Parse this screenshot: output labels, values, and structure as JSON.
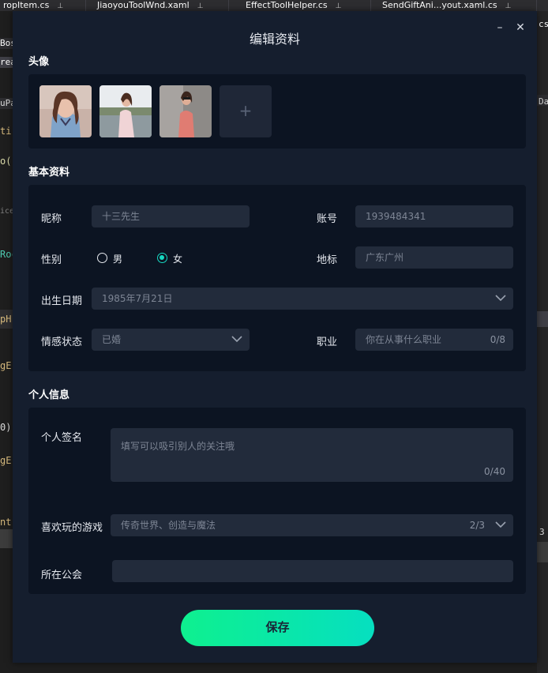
{
  "ide": {
    "tabs": [
      "ropItem.cs",
      "JiaoyouToolWnd.xaml",
      "EffectToolHelper.cs",
      "SendGiftAni...yout.xaml.cs"
    ],
    "left_fragments": [
      "Bos",
      "rea",
      "uPa",
      "ti",
      "o(",
      "ice",
      "Roc",
      "pH",
      "gE",
      "0)",
      "gE",
      "nt"
    ],
    "right_fragments": [
      "cs",
      "Da",
      "3"
    ]
  },
  "dialog": {
    "title": "编辑资料",
    "minimize_glyph": "–",
    "close_glyph": "✕",
    "avatar_section": {
      "title": "头像",
      "add_glyph": "+"
    },
    "basic_section": {
      "title": "基本资料",
      "nickname": {
        "label": "昵称",
        "value": "十三先生"
      },
      "account": {
        "label": "账号",
        "value": "1939484341"
      },
      "gender": {
        "label": "性别",
        "options": [
          "男",
          "女"
        ],
        "selected": "女"
      },
      "location": {
        "label": "地标",
        "value": "广东广州"
      },
      "birthday": {
        "label": "出生日期",
        "value": "1985年7月21日"
      },
      "relationship": {
        "label": "情感状态",
        "value": "已婚"
      },
      "occupation": {
        "label": "职业",
        "placeholder": "你在从事什么职业",
        "counter": "0/8"
      }
    },
    "personal_section": {
      "title": "个人信息",
      "signature": {
        "label": "个人签名",
        "placeholder": "填写可以吸引别人的关注哦",
        "counter": "0/40"
      },
      "games": {
        "label": "喜欢玩的游戏",
        "value": "传奇世界、创造与魔法",
        "counter": "2/3"
      },
      "guild": {
        "label": "所在公会",
        "value": ""
      }
    },
    "save_label": "保存"
  },
  "colors": {
    "dialog_bg": "#151e2e",
    "panel_bg": "#0c1422",
    "field_bg": "#222b3b",
    "accent": "#17d9c2",
    "save_gradient_start": "#0ef08f",
    "save_gradient_end": "#06dfc0"
  }
}
